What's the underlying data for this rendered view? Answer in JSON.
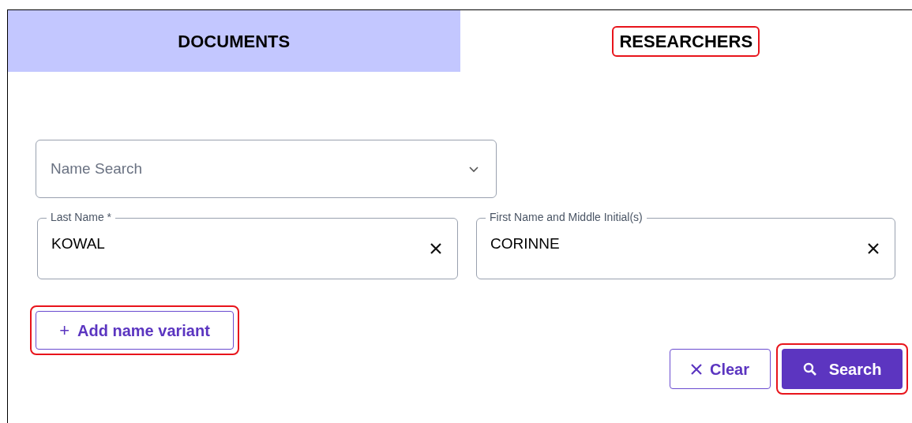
{
  "tabs": [
    {
      "label": "DOCUMENTS",
      "selected": false,
      "highlighted": false
    },
    {
      "label": "RESEARCHERS",
      "selected": true,
      "highlighted": true
    }
  ],
  "name_search": {
    "placeholder": "Name Search"
  },
  "fields": [
    {
      "label": "Last Name *",
      "value": "KOWAL"
    },
    {
      "label": "First Name and Middle Initial(s)",
      "value": "CORINNE"
    }
  ],
  "add_variant_button": {
    "icon": "+",
    "label": "Add name variant",
    "highlighted": true
  },
  "actions": [
    {
      "kind": "clear",
      "label": "Clear",
      "highlighted": false
    },
    {
      "kind": "search",
      "label": "Search",
      "highlighted": true
    }
  ]
}
